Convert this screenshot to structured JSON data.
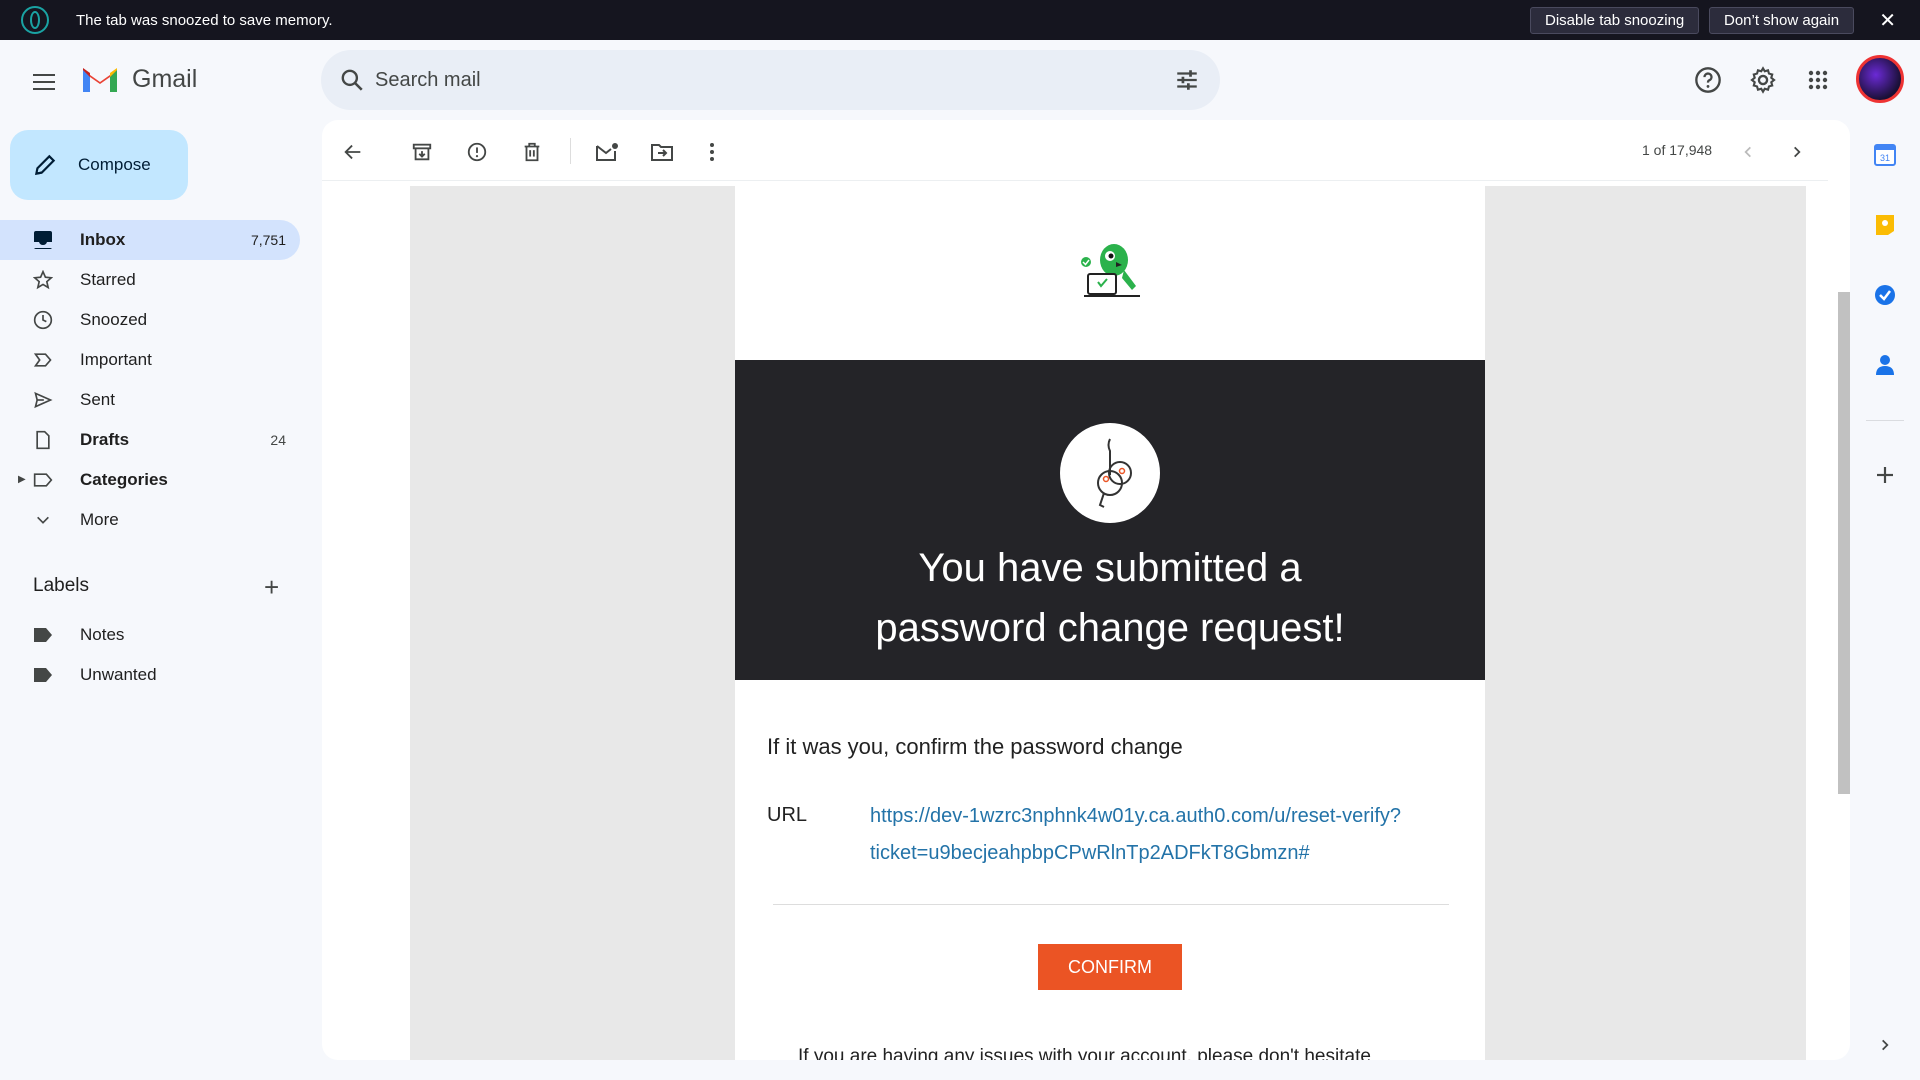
{
  "snooze_bar": {
    "message": "The tab was snoozed to save memory.",
    "disable_label": "Disable tab snoozing",
    "dont_show_label": "Don’t show again"
  },
  "header": {
    "app_name": "Gmail",
    "search_placeholder": "Search mail"
  },
  "sidebar": {
    "compose_label": "Compose",
    "items": [
      {
        "label": "Inbox",
        "count": "7,751",
        "icon": "inbox-icon"
      },
      {
        "label": "Starred",
        "count": "",
        "icon": "star-icon"
      },
      {
        "label": "Snoozed",
        "count": "",
        "icon": "clock-icon"
      },
      {
        "label": "Important",
        "count": "",
        "icon": "important-icon"
      },
      {
        "label": "Sent",
        "count": "",
        "icon": "send-icon"
      },
      {
        "label": "Drafts",
        "count": "24",
        "icon": "draft-icon"
      },
      {
        "label": "Categories",
        "count": "",
        "icon": "label-icon"
      },
      {
        "label": "More",
        "count": "",
        "icon": "chevron-down-icon"
      }
    ],
    "labels_title": "Labels",
    "labels": [
      {
        "label": "Notes"
      },
      {
        "label": "Unwanted"
      }
    ]
  },
  "toolbar": {
    "pager": "1 of 17,948"
  },
  "email": {
    "hero_title_line1": "You have submitted a",
    "hero_title_line2": "password change request!",
    "confirm_prompt": "If it was you, confirm the password change",
    "url_label": "URL",
    "url_line1": "https://dev-1wzrc3nphnk4w01y.ca.auth0.com/u/reset-verify?",
    "url_line2": "ticket=u9becjeahpbpCPwRlnTp2ADFkT8Gbmzn#",
    "confirm_button": "CONFIRM",
    "footer_text": "If you are having any issues with your account, please don't hesitate"
  },
  "colors": {
    "hero_bg": "#242428",
    "confirm_btn": "#eb5424",
    "link": "#2373a8",
    "active_nav": "#d3e3fd",
    "compose_bg": "#c2e7ff"
  }
}
